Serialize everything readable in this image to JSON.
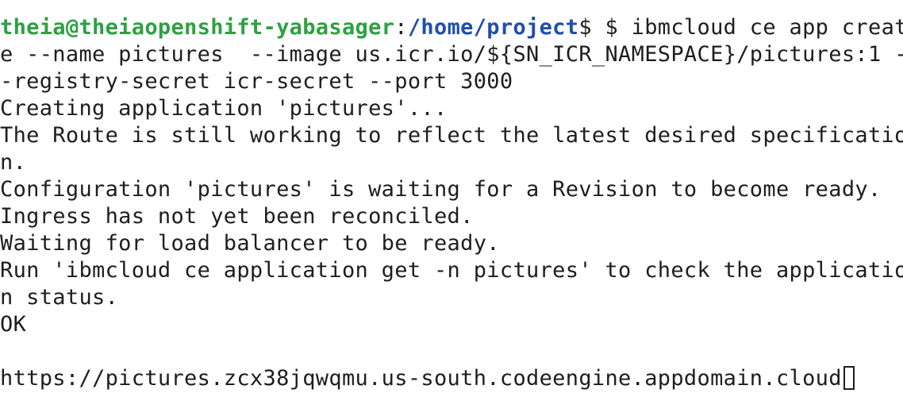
{
  "terminal": {
    "top_partial_line": "  ",
    "prompt": {
      "user_host": "theia@theiaopenshift-yabasager",
      "separator": ":",
      "path": "/home/project",
      "symbol": "$",
      "command_line_1": " $ ibmcloud ce app creat"
    },
    "output_lines": [
      "e --name pictures  --image us.icr.io/${SN_ICR_NAMESPACE}/pictures:1 -",
      "-registry-secret icr-secret --port 3000",
      "Creating application 'pictures'...",
      "The Route is still working to reflect the latest desired specificatio",
      "n.",
      "Configuration 'pictures' is waiting for a Revision to become ready.",
      "Ingress has not yet been reconciled.",
      "Waiting for load balancer to be ready.",
      "Run 'ibmcloud ce application get -n pictures' to check the applicatio",
      "n status.",
      "OK",
      "",
      "https://pictures.zcx38jqwqmu.us-south.codeengine.appdomain.cloud"
    ]
  }
}
